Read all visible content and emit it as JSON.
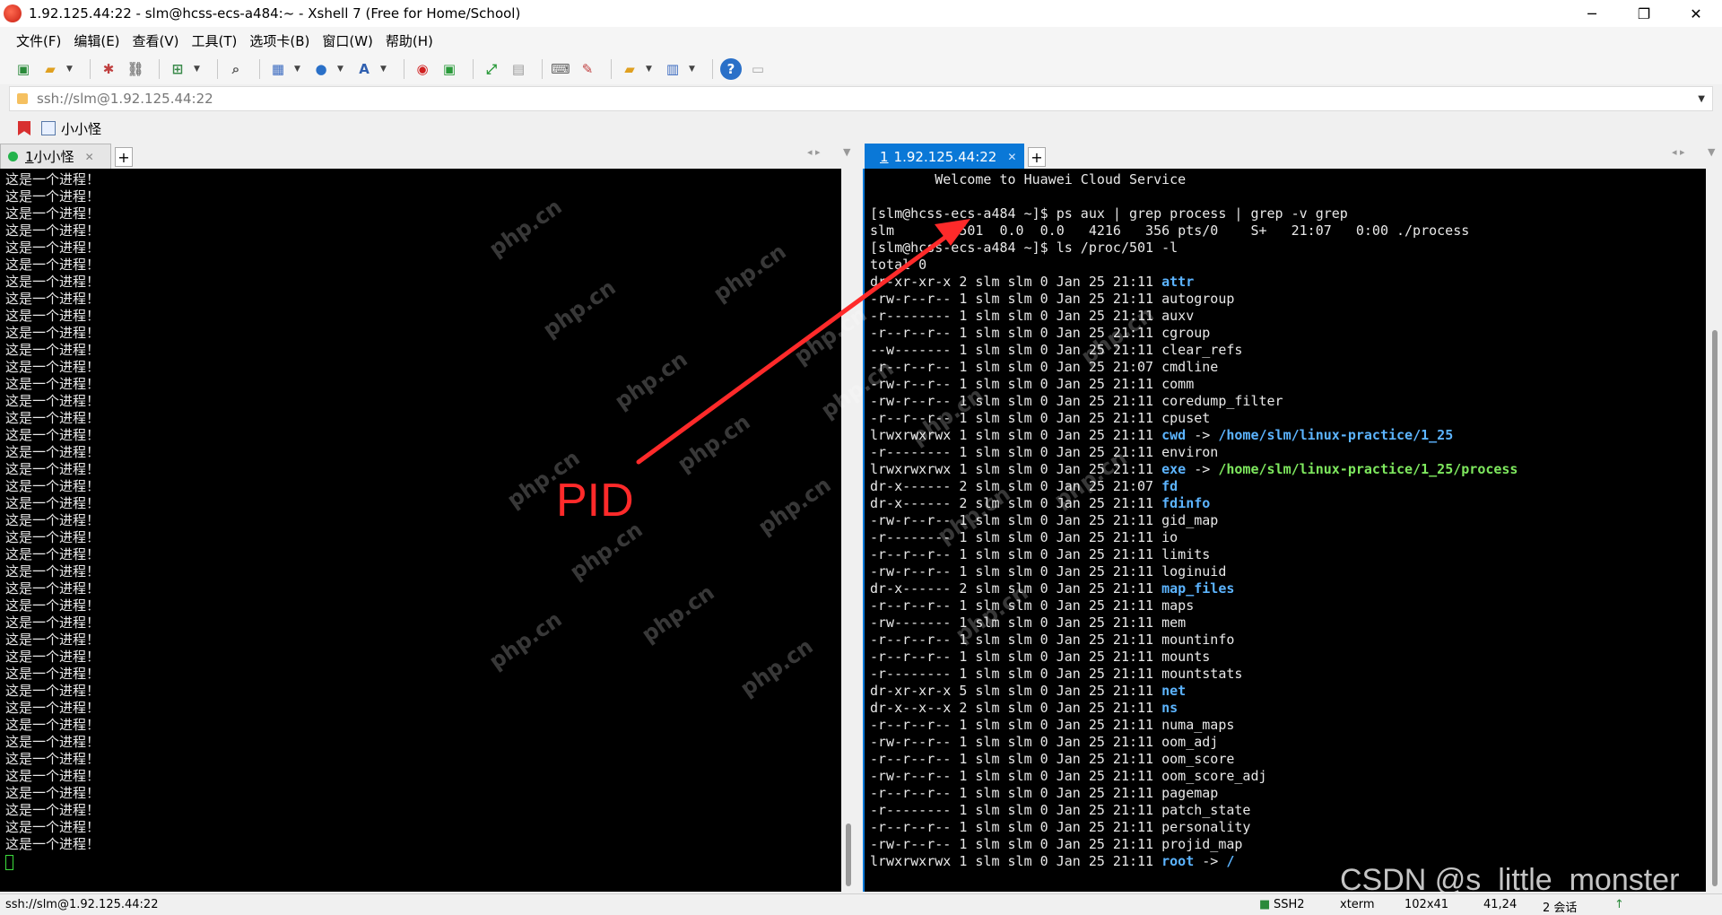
{
  "window": {
    "title": "1.92.125.44:22 - slm@hcss-ecs-a484:~ - Xshell 7 (Free for Home/School)",
    "minimize": "─",
    "maximize": "❐",
    "close": "✕"
  },
  "menu": [
    "文件(F)",
    "编辑(E)",
    "查看(V)",
    "工具(T)",
    "选项卡(B)",
    "窗口(W)",
    "帮助(H)"
  ],
  "address": {
    "value": "ssh://slm@1.92.125.44:22"
  },
  "quicklink": {
    "label": "小小怪"
  },
  "left_tab": {
    "index": "1",
    "label": "小小怪",
    "close": "✕"
  },
  "right_tab": {
    "index": "1",
    "label": "1.92.125.44:22",
    "close": "✕"
  },
  "tab_add": "+",
  "left_terminal": {
    "line_text": "这是一个进程！",
    "line_count": 40
  },
  "right_terminal": {
    "welcome": "        Welcome to Huawei Cloud Service",
    "cmd1": "[slm@hcss-ecs-a484 ~]$ ps aux | grep process | grep -v grep",
    "ps_row": "slm        501  0.0  0.0   4216   356 pts/0    S+   21:07   0:00 ./process",
    "cmd2": "[slm@hcss-ecs-a484 ~]$ ls /proc/501 -l",
    "total": "total 0",
    "entries": [
      {
        "perm": "dr-xr-xr-x",
        "links": "2",
        "time": "21:11",
        "name": "attr",
        "cls": "blue",
        "target": ""
      },
      {
        "perm": "-rw-r--r--",
        "links": "1",
        "time": "21:11",
        "name": "autogroup",
        "cls": "",
        "target": ""
      },
      {
        "perm": "-r--------",
        "links": "1",
        "time": "21:11",
        "name": "auxv",
        "cls": "",
        "target": ""
      },
      {
        "perm": "-r--r--r--",
        "links": "1",
        "time": "21:11",
        "name": "cgroup",
        "cls": "",
        "target": ""
      },
      {
        "perm": "--w-------",
        "links": "1",
        "time": "21:11",
        "name": "clear_refs",
        "cls": "",
        "target": ""
      },
      {
        "perm": "-r--r--r--",
        "links": "1",
        "time": "21:07",
        "name": "cmdline",
        "cls": "",
        "target": ""
      },
      {
        "perm": "-rw-r--r--",
        "links": "1",
        "time": "21:11",
        "name": "comm",
        "cls": "",
        "target": ""
      },
      {
        "perm": "-rw-r--r--",
        "links": "1",
        "time": "21:11",
        "name": "coredump_filter",
        "cls": "",
        "target": ""
      },
      {
        "perm": "-r--r--r--",
        "links": "1",
        "time": "21:11",
        "name": "cpuset",
        "cls": "",
        "target": ""
      },
      {
        "perm": "lrwxrwxrwx",
        "links": "1",
        "time": "21:11",
        "name": "cwd",
        "cls": "blue",
        "target": "/home/slm/linux-practice/1_25"
      },
      {
        "perm": "-r--------",
        "links": "1",
        "time": "21:11",
        "name": "environ",
        "cls": "",
        "target": ""
      },
      {
        "perm": "lrwxrwxrwx",
        "links": "1",
        "time": "21:11",
        "name": "exe",
        "cls": "blue",
        "target": "/home/slm/linux-practice/1_25/process"
      },
      {
        "perm": "dr-x------",
        "links": "2",
        "time": "21:07",
        "name": "fd",
        "cls": "blue",
        "target": ""
      },
      {
        "perm": "dr-x------",
        "links": "2",
        "time": "21:11",
        "name": "fdinfo",
        "cls": "blue",
        "target": ""
      },
      {
        "perm": "-rw-r--r--",
        "links": "1",
        "time": "21:11",
        "name": "gid_map",
        "cls": "",
        "target": ""
      },
      {
        "perm": "-r--------",
        "links": "1",
        "time": "21:11",
        "name": "io",
        "cls": "",
        "target": ""
      },
      {
        "perm": "-r--r--r--",
        "links": "1",
        "time": "21:11",
        "name": "limits",
        "cls": "",
        "target": ""
      },
      {
        "perm": "-rw-r--r--",
        "links": "1",
        "time": "21:11",
        "name": "loginuid",
        "cls": "",
        "target": ""
      },
      {
        "perm": "dr-x------",
        "links": "2",
        "time": "21:11",
        "name": "map_files",
        "cls": "blue",
        "target": ""
      },
      {
        "perm": "-r--r--r--",
        "links": "1",
        "time": "21:11",
        "name": "maps",
        "cls": "",
        "target": ""
      },
      {
        "perm": "-rw-------",
        "links": "1",
        "time": "21:11",
        "name": "mem",
        "cls": "",
        "target": ""
      },
      {
        "perm": "-r--r--r--",
        "links": "1",
        "time": "21:11",
        "name": "mountinfo",
        "cls": "",
        "target": ""
      },
      {
        "perm": "-r--r--r--",
        "links": "1",
        "time": "21:11",
        "name": "mounts",
        "cls": "",
        "target": ""
      },
      {
        "perm": "-r--------",
        "links": "1",
        "time": "21:11",
        "name": "mountstats",
        "cls": "",
        "target": ""
      },
      {
        "perm": "dr-xr-xr-x",
        "links": "5",
        "time": "21:11",
        "name": "net",
        "cls": "blue",
        "target": ""
      },
      {
        "perm": "dr-x--x--x",
        "links": "2",
        "time": "21:11",
        "name": "ns",
        "cls": "blue",
        "target": ""
      },
      {
        "perm": "-r--r--r--",
        "links": "1",
        "time": "21:11",
        "name": "numa_maps",
        "cls": "",
        "target": ""
      },
      {
        "perm": "-rw-r--r--",
        "links": "1",
        "time": "21:11",
        "name": "oom_adj",
        "cls": "",
        "target": ""
      },
      {
        "perm": "-r--r--r--",
        "links": "1",
        "time": "21:11",
        "name": "oom_score",
        "cls": "",
        "target": ""
      },
      {
        "perm": "-rw-r--r--",
        "links": "1",
        "time": "21:11",
        "name": "oom_score_adj",
        "cls": "",
        "target": ""
      },
      {
        "perm": "-r--r--r--",
        "links": "1",
        "time": "21:11",
        "name": "pagemap",
        "cls": "",
        "target": ""
      },
      {
        "perm": "-r--------",
        "links": "1",
        "time": "21:11",
        "name": "patch_state",
        "cls": "",
        "target": ""
      },
      {
        "perm": "-r--r--r--",
        "links": "1",
        "time": "21:11",
        "name": "personality",
        "cls": "",
        "target": ""
      },
      {
        "perm": "-rw-r--r--",
        "links": "1",
        "time": "21:11",
        "name": "projid_map",
        "cls": "",
        "target": ""
      },
      {
        "perm": "lrwxrwxrwx",
        "links": "1",
        "time": "21:11",
        "name": "root",
        "cls": "blue",
        "target": "/"
      }
    ],
    "owner": "slm slm 0 Jan 25",
    "exe_target_cls": "green"
  },
  "annotation": {
    "label": "PID"
  },
  "watermark": {
    "site": "php.cn",
    "csdn": "CSDN @s_little_monster_"
  },
  "status": {
    "session": "ssh://slm@1.92.125.44:22",
    "protocol": "SSH2",
    "term": "xterm",
    "size": "102x41",
    "cursor": "41,24",
    "sessions": "2 会话"
  },
  "colors": {
    "dir": "#5cb4ff",
    "exec": "#7ee85e",
    "arrow": "#ff2a2a",
    "tab_active": "#0a78d7"
  }
}
